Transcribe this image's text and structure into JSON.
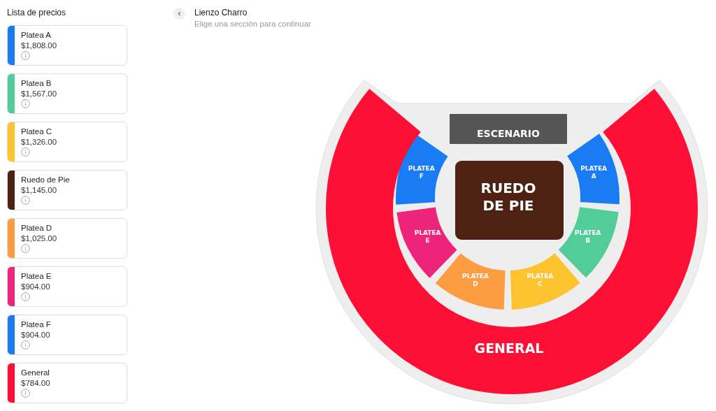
{
  "sidebar": {
    "title": "Lista de precios",
    "items": [
      {
        "name": "Platea A",
        "price": "$1,808.00",
        "color": "#1a7cf5"
      },
      {
        "name": "Platea B",
        "price": "$1,567.00",
        "color": "#52cc98"
      },
      {
        "name": "Platea C",
        "price": "$1,326.00",
        "color": "#fec430"
      },
      {
        "name": "Ruedo de Pie",
        "price": "$1,145.00",
        "color": "#4e2212"
      },
      {
        "name": "Platea D",
        "price": "$1,025.00",
        "color": "#fd9c41"
      },
      {
        "name": "Platea E",
        "price": "$904.00",
        "color": "#ee247a"
      },
      {
        "name": "Platea F",
        "price": "$904.00",
        "color": "#1a7cf5"
      },
      {
        "name": "General",
        "price": "$784.00",
        "color": "#fe0f35"
      }
    ]
  },
  "header": {
    "back": "‹",
    "title": "Lienzo Charro",
    "subtitle": "Elige una sección para continuar"
  },
  "map": {
    "sections": [
      {
        "kind": "stage",
        "lines": [
          "ESCENARIO"
        ],
        "color": "#555555"
      },
      {
        "kind": "ring",
        "lines": [
          "PLATEA",
          "F"
        ],
        "color": "#1a7cf5"
      },
      {
        "kind": "ring",
        "lines": [
          "PLATEA",
          "A"
        ],
        "color": "#1a7cf5"
      },
      {
        "kind": "center",
        "lines": [
          "RUEDO",
          "DE PIE"
        ],
        "color": "#4e2212"
      },
      {
        "kind": "ring",
        "lines": [
          "PLATEA",
          "E"
        ],
        "color": "#ee247a"
      },
      {
        "kind": "ring",
        "lines": [
          "PLATEA",
          "B"
        ],
        "color": "#52cc98"
      },
      {
        "kind": "ring",
        "lines": [
          "PLATEA",
          "D"
        ],
        "color": "#fd9c41"
      },
      {
        "kind": "ring",
        "lines": [
          "PLATEA",
          "C"
        ],
        "color": "#fec430"
      },
      {
        "kind": "general",
        "lines": [
          "GENERAL"
        ],
        "color": "#fe0f35"
      }
    ]
  }
}
